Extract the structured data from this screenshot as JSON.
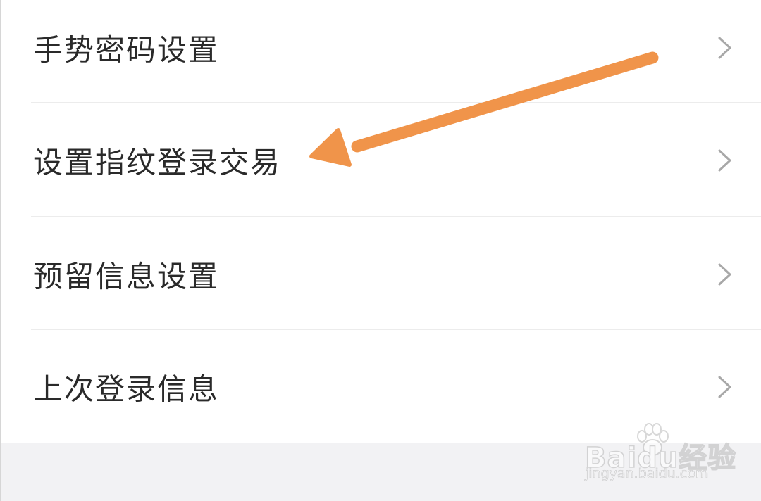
{
  "settings": {
    "items": [
      {
        "label": "手势密码设置",
        "icon": "chevron-right-icon"
      },
      {
        "label": "设置指纹登录交易",
        "icon": "chevron-right-icon"
      },
      {
        "label": "预留信息设置",
        "icon": "chevron-right-icon"
      },
      {
        "label": "上次登录信息",
        "icon": "chevron-right-icon"
      }
    ]
  },
  "annotation": {
    "arrow_color": "#f0944a",
    "points_to": "设置指纹登录交易"
  },
  "watermark": {
    "brand": "Baidu经验",
    "url": "jingyan.baidu.com"
  },
  "colors": {
    "background": "#f2f2f4",
    "list_background": "#ffffff",
    "text": "#2a2a2a",
    "divider": "#ececec",
    "chevron": "#a8a8a8"
  }
}
